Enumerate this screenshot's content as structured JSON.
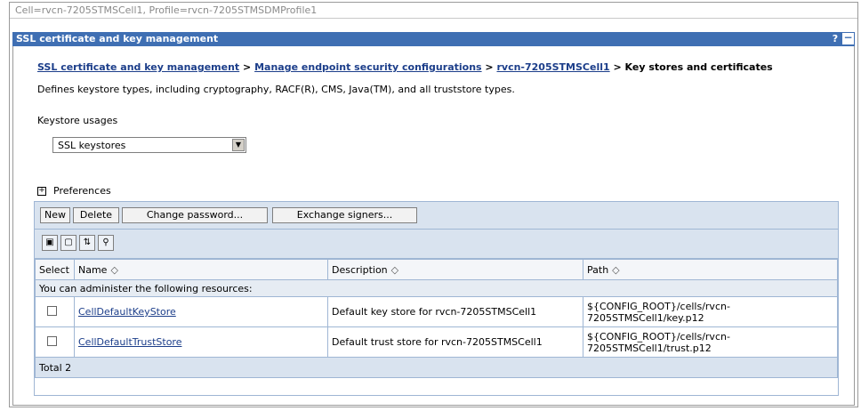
{
  "cell_bar": "Cell=rvcn-7205STMSCell1, Profile=rvcn-7205STMSDMProfile1",
  "title": "SSL certificate and key management",
  "title_icons": {
    "help": "?",
    "minimize": "−"
  },
  "breadcrumb": {
    "items": [
      "SSL certificate and key management",
      "Manage endpoint security configurations",
      "rvcn-7205STMSCell1"
    ],
    "separator": ">",
    "current": "Key stores and certificates"
  },
  "description": "Defines keystore types, including cryptography, RACF(R), CMS, Java(TM), and all truststore types.",
  "keystore_usages": {
    "label": "Keystore usages",
    "selected": "SSL keystores"
  },
  "preferences": {
    "toggle": "+",
    "label": "Preferences"
  },
  "toolbar": {
    "new": "New",
    "delete": "Delete",
    "change_password": "Change password...",
    "exchange_signers": "Exchange signers..."
  },
  "table": {
    "headers": {
      "select": "Select",
      "name": "Name",
      "description": "Description",
      "path": "Path"
    },
    "sort_glyph": "◇",
    "resources_note": "You can administer the following resources:",
    "rows": [
      {
        "name": "CellDefaultKeyStore",
        "description": "Default key store for rvcn-7205STMSCell1",
        "path_line1": "${CONFIG_ROOT}/cells/rvcn-",
        "path_line2": "7205STMSCell1/key.p12"
      },
      {
        "name": "CellDefaultTrustStore",
        "description": "Default trust store for rvcn-7205STMSCell1",
        "path_line1": "${CONFIG_ROOT}/cells/rvcn-",
        "path_line2": "7205STMSCell1/trust.p12"
      }
    ],
    "total": "Total 2"
  },
  "icons": [
    "select-all-icon",
    "deselect-all-icon",
    "show-filter-icon",
    "clear-filter-icon"
  ]
}
